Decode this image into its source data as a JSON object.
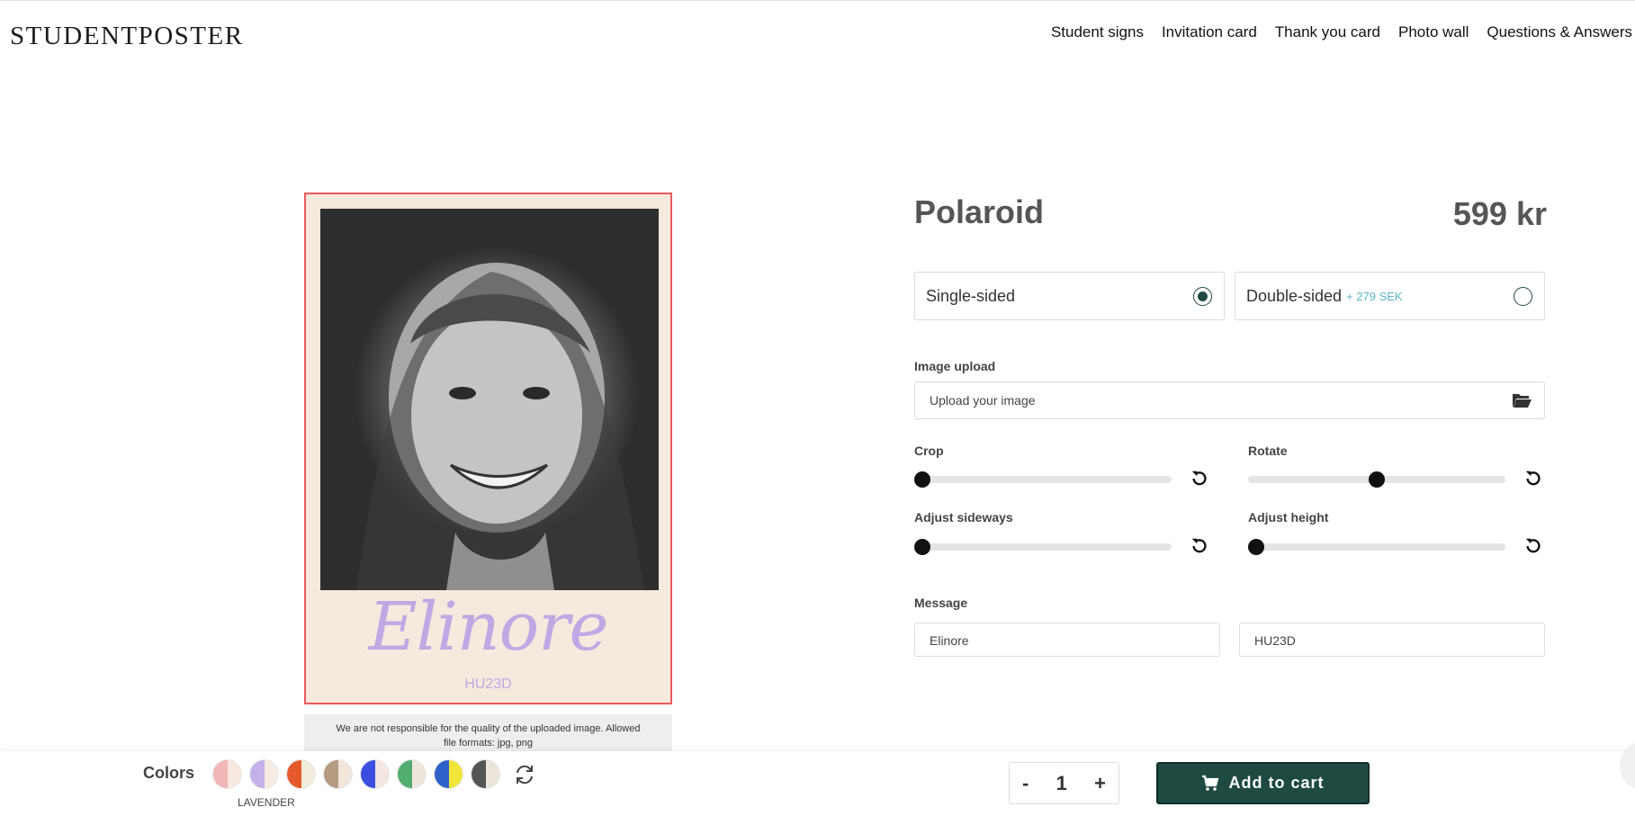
{
  "header": {
    "logo": "STUDENTPOSTER",
    "nav": [
      "Student signs",
      "Invitation card",
      "Thank you card",
      "Photo wall",
      "Questions & Answers"
    ]
  },
  "preview": {
    "name": "Elinore",
    "code": "HU23D",
    "disclaimer": "We are not responsible for the quality of the uploaded image. Allowed file formats: jpg, png"
  },
  "product": {
    "title": "Polaroid",
    "price": "599 kr",
    "options": [
      {
        "label": "Single-sided",
        "extra": "",
        "selected": true
      },
      {
        "label": "Double-sided",
        "extra": "+ 279 SEK",
        "selected": false
      }
    ],
    "upload": {
      "label": "Image upload",
      "placeholder": "Upload your image"
    },
    "sliders": {
      "crop": {
        "label": "Crop",
        "value": 0.0
      },
      "rotate": {
        "label": "Rotate",
        "value": 0.5
      },
      "sideways": {
        "label": "Adjust sideways",
        "value": 0.0
      },
      "height": {
        "label": "Adjust height",
        "value": 0.0
      }
    },
    "message": {
      "label": "Message",
      "line1": "Elinore",
      "line2": "HU23D"
    }
  },
  "bottombar": {
    "colors_label": "Colors",
    "selected_color": "LAVENDER",
    "swatches": [
      {
        "name": "pink-swatch",
        "left": "#f0b6b8",
        "right": "#f7e9e0"
      },
      {
        "name": "lavender-swatch",
        "left": "#c3b2ea",
        "right": "#f5ebe2"
      },
      {
        "name": "orange-swatch",
        "left": "#e55a2c",
        "right": "#f3ecda"
      },
      {
        "name": "tan-swatch",
        "left": "#b59a82",
        "right": "#f1e5dc"
      },
      {
        "name": "blue-swatch",
        "left": "#3a4fe0",
        "right": "#f4e6e2"
      },
      {
        "name": "green-swatch",
        "left": "#52ad70",
        "right": "#eee6dc"
      },
      {
        "name": "blue-yellow-swatch",
        "left": "#2f62c9",
        "right": "#f2e53a"
      },
      {
        "name": "grey-swatch",
        "left": "#555555",
        "right": "#ebe4d9"
      }
    ],
    "quantity": {
      "minus": "-",
      "value": "1",
      "plus": "+"
    },
    "cart_label": "Add to cart"
  },
  "colors": {
    "accent": "#1f4a42",
    "poster_bg": "#f6e9dd",
    "name_color": "#bfa8e4",
    "info": "#5bb5c9"
  }
}
